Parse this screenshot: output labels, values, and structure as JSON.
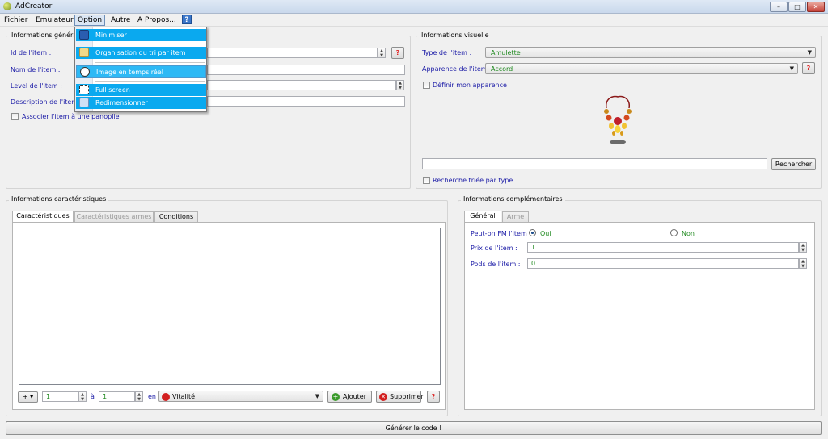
{
  "window": {
    "title": "AdCreator",
    "min": "–",
    "max": "□",
    "close": "✕"
  },
  "menubar": [
    "Fichier",
    "Emulateur",
    "Option",
    "Autre",
    "A Propos..."
  ],
  "help_icon": "?",
  "option_menu": {
    "items": [
      "Minimiser",
      "Organisation du tri par item",
      "Image en temps réel",
      "Full screen",
      "Redimensionner"
    ]
  },
  "info_generales": {
    "title": "Informations générales",
    "id_label": "Id de l'item :",
    "nom_label": "Nom de l'item :",
    "level_label": "Level de l'item :",
    "desc_label": "Description de l'item :",
    "panoplie_label": "Associer l'item à une panoplie",
    "help": "?"
  },
  "info_visuelle": {
    "title": "Informations visuelle",
    "type_label": "Type de l'item :",
    "type_value": "Amulette",
    "apparence_label": "Apparence de l'item :",
    "apparence_value": "Accord",
    "definir_label": "Définir mon apparence",
    "search_button": "Rechercher",
    "search_sorted_label": "Recherche triée par type",
    "help": "?"
  },
  "info_caracteristiques": {
    "title": "Informations caractéristiques",
    "tabs": [
      "Caractéristiques",
      "Caractéristiques armes",
      "Conditions"
    ],
    "sign": "+",
    "from_value": "1",
    "a_label": "à",
    "to_value": "1",
    "en_label": "en",
    "stat_value": "Vitalité",
    "add_button": "Ajouter",
    "delete_button": "Supprimer",
    "help": "?"
  },
  "info_complementaires": {
    "title": "Informations complémentaires",
    "tabs": [
      "Général",
      "Arme"
    ],
    "fm_label": "Peut-on FM l'item :",
    "oui": "Oui",
    "non": "Non",
    "prix_label": "Prix de l'item :",
    "prix_value": "1",
    "pods_label": "Pods de l'item :",
    "pods_value": "0"
  },
  "generate_button": "Générer le code !",
  "colors": {
    "menu_highlight": "#0aa9ef",
    "label_blue": "#1a1aa6",
    "value_green": "#228b22"
  }
}
